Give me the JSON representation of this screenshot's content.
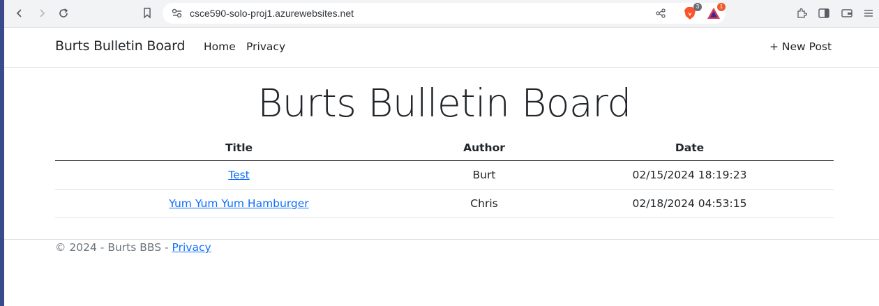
{
  "browser": {
    "url": "csce590-solo-proj1.azurewebsites.net",
    "shields_count": "3",
    "rewards_count": "1"
  },
  "navbar": {
    "brand": "Burts Bulletin Board",
    "links": [
      "Home",
      "Privacy"
    ],
    "new_post": "+ New Post"
  },
  "main": {
    "heading": "Burts Bulletin Board",
    "columns": [
      "Title",
      "Author",
      "Date"
    ],
    "rows": [
      {
        "title": "Test",
        "author": "Burt",
        "date": "02/15/2024 18:19:23"
      },
      {
        "title": "Yum Yum Yum Hamburger",
        "author": "Chris",
        "date": "02/18/2024 04:53:15"
      }
    ]
  },
  "footer": {
    "copyright": "© 2024 - Burts BBS - ",
    "privacy_link": "Privacy"
  },
  "colors": {
    "link": "#0d6efd",
    "text": "#212529",
    "muted": "#6c757d",
    "desktop": "#3a4a8a"
  }
}
